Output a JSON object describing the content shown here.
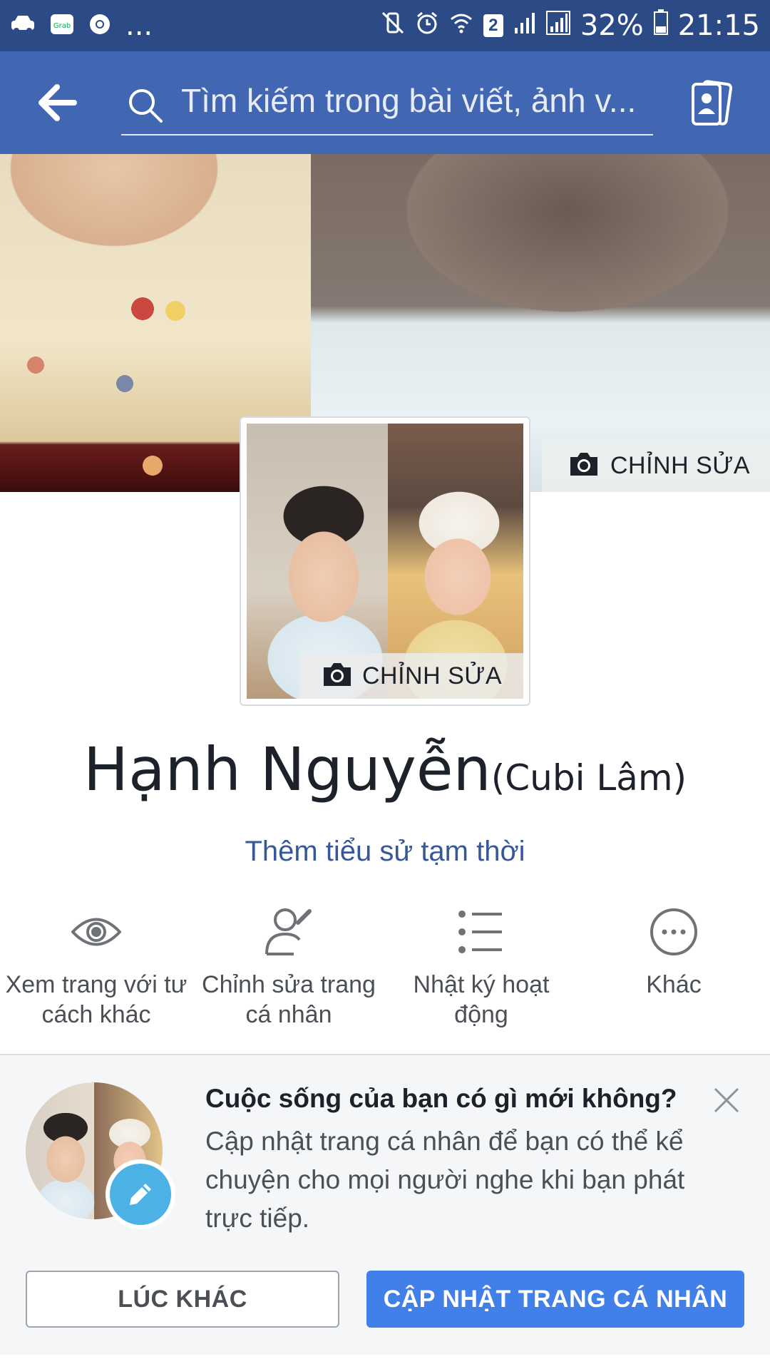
{
  "status_bar": {
    "more_label": "...",
    "sim_slot": "2",
    "battery": "32%",
    "time": "21:15",
    "icons": [
      "car-icon",
      "grab-icon",
      "chrome-icon",
      "mute-vibrate-icon",
      "alarm-icon",
      "wifi-icon",
      "signal-icon",
      "signal-icon",
      "battery-icon"
    ]
  },
  "app_bar": {
    "search_placeholder": "Tìm kiếm trong bài viết, ảnh v...",
    "background": "#4267b2"
  },
  "cover": {
    "edit_label": "CHỈNH SỬA"
  },
  "profile_photo": {
    "edit_label": "CHỈNH SỬA"
  },
  "profile": {
    "name": "Hạnh Nguyễn",
    "alternate_name": "(Cubi Lâm)",
    "bio_link": "Thêm tiểu sử tạm thời"
  },
  "actions": [
    {
      "icon": "eye-icon",
      "label": "Xem trang với tư cách khác"
    },
    {
      "icon": "edit-profile-icon",
      "label": "Chỉnh sửa trang cá nhân"
    },
    {
      "icon": "list-icon",
      "label": "Nhật ký hoạt động"
    },
    {
      "icon": "more-icon",
      "label": "Khác"
    }
  ],
  "prompt": {
    "title": "Cuộc sống của bạn có gì mới không?",
    "body": "Cập nhật trang cá nhân để bạn có thể kể chuyện cho mọi người nghe khi bạn phát trực tiếp.",
    "later_label": "LÚC KHÁC",
    "update_label": "CẬP NHẬT TRANG CÁ NHÂN",
    "accent": "#4080e8"
  }
}
